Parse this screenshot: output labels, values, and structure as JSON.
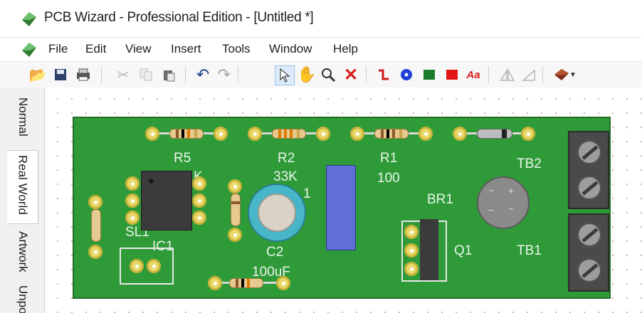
{
  "window": {
    "title": "PCB Wizard - Professional Edition - [Untitled *]"
  },
  "menu": {
    "items": [
      "File",
      "Edit",
      "View",
      "Insert",
      "Tools",
      "Window",
      "Help"
    ]
  },
  "toolbar": {
    "icons": [
      "open-icon",
      "save-icon",
      "print-icon",
      "cut-icon",
      "copy-icon",
      "paste-icon",
      "undo-icon",
      "redo-icon",
      "select-icon",
      "pan-icon",
      "zoom-icon",
      "delete-icon",
      "track-icon",
      "pad-icon",
      "square-pad-icon",
      "fill-icon",
      "text-icon",
      "mirror-icon",
      "rotate-icon",
      "component-icon"
    ],
    "text_tool_label": "Aa"
  },
  "tabs": {
    "items": [
      "Normal",
      "Real World",
      "Artwork",
      "Unpopul"
    ],
    "active": "Real World"
  },
  "board": {
    "labels": {
      "r5": "R5",
      "r5_value": "K",
      "r2": "R2",
      "r2_value": "33K",
      "r1": "R1",
      "r1_value": "100",
      "tb2": "TB2",
      "br1": "BR1",
      "sl1": "SL1",
      "ic1": "IC1",
      "c2": "C2",
      "c2_value": "100uF",
      "c2_fragment": "1",
      "q1": "Q1",
      "tb1": "TB1"
    }
  },
  "colors": {
    "board": "#2f9a38",
    "pad": "#e9d96a",
    "capacitor": "#47b6c9",
    "trimmer": "#5f6fd6"
  }
}
